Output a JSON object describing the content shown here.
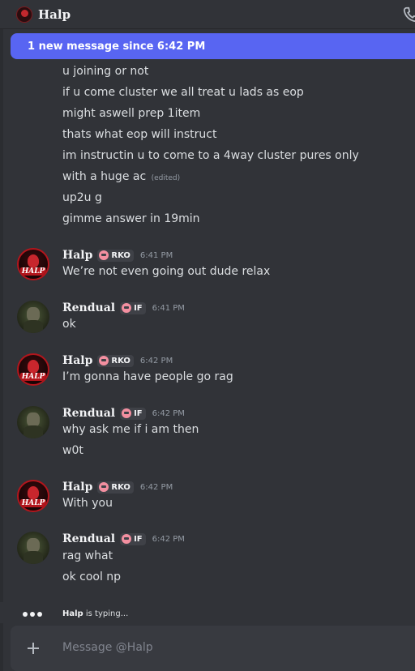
{
  "topbar": {
    "name": "Halp"
  },
  "banner": {
    "text": "1 new message since 6:42 PM"
  },
  "earlier_lines": [
    "u joining or not",
    "if u come cluster we all treat u lads as eop",
    "might aswell prep 1item",
    "thats what eop will instruct",
    "im instructin u to come to a 4way cluster pures only",
    "with a huge ac",
    "up2u g",
    "gimme answer in 19min"
  ],
  "edited_label": "(edited)",
  "messages": [
    {
      "user": "Halp",
      "tag": "RKO",
      "time": "6:41 PM",
      "avatar_text": "HALP",
      "lines": [
        "We’re not even going out dude relax"
      ]
    },
    {
      "user": "Rendual",
      "tag": "IF",
      "time": "6:41 PM",
      "lines": [
        "ok"
      ]
    },
    {
      "user": "Halp",
      "tag": "RKO",
      "time": "6:42 PM",
      "avatar_text": "HALP",
      "lines": [
        "I’m gonna have people go rag"
      ]
    },
    {
      "user": "Rendual",
      "tag": "IF",
      "time": "6:42 PM",
      "lines": [
        "why ask me if i am then",
        "w0t"
      ]
    },
    {
      "user": "Halp",
      "tag": "RKO",
      "time": "6:42 PM",
      "avatar_text": "HALP",
      "lines": [
        "With you"
      ]
    },
    {
      "user": "Rendual",
      "tag": "IF",
      "time": "6:42 PM",
      "lines": [
        "rag what",
        "ok cool np"
      ]
    }
  ],
  "typing": {
    "user": "Halp",
    "text": "is typing..."
  },
  "composer": {
    "placeholder": "Message @Halp"
  },
  "colors": {
    "background": "#313338",
    "accent": "#5865f2",
    "composer": "#383a40",
    "tag_bg": "#3f4147"
  }
}
